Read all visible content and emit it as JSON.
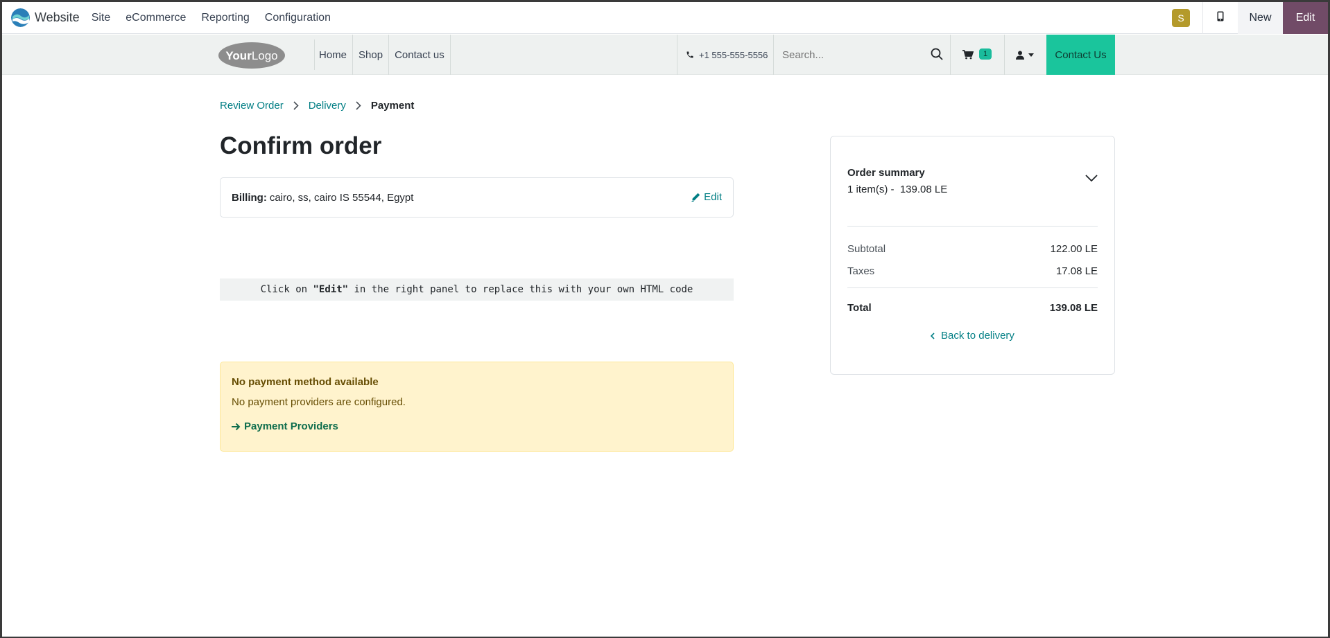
{
  "topbar": {
    "app_name": "Website",
    "menu": [
      "Site",
      "eCommerce",
      "Reporting",
      "Configuration"
    ],
    "avatar_letter": "S",
    "new_label": "New",
    "edit_label": "Edit",
    "colors": {
      "edit_bg": "#714b67",
      "avatar_bg": "#b49a2b"
    }
  },
  "site_header": {
    "logo_text": "YourLogo",
    "nav": [
      "Home",
      "Shop",
      "Contact us"
    ],
    "phone": "+1 555-555-5556",
    "search_placeholder": "Search...",
    "cart_count": "1",
    "contact_button": "Contact Us",
    "colors": {
      "accent": "#1ac59c"
    }
  },
  "breadcrumb": {
    "items": [
      "Review Order",
      "Delivery"
    ],
    "current": "Payment"
  },
  "page_title": "Confirm order",
  "billing": {
    "label": "Billing:",
    "address": "cairo, ss, cairo IS 55544, Egypt",
    "edit_label": "Edit"
  },
  "code_block": {
    "prefix": "Click on ",
    "bold": "\"Edit\"",
    "suffix": " in the right panel to replace this with your own HTML code"
  },
  "alert": {
    "title": "No payment method available",
    "text": "No payment providers are configured.",
    "link": "Payment Providers"
  },
  "summary": {
    "title": "Order summary",
    "items": "1 item(s) -  139.08 LE",
    "rows": [
      {
        "label": "Subtotal",
        "value": "122.00 LE"
      },
      {
        "label": "Taxes",
        "value": "17.08 LE"
      }
    ],
    "total_label": "Total",
    "total_value": "139.08 LE",
    "back_link": "Back to delivery"
  }
}
